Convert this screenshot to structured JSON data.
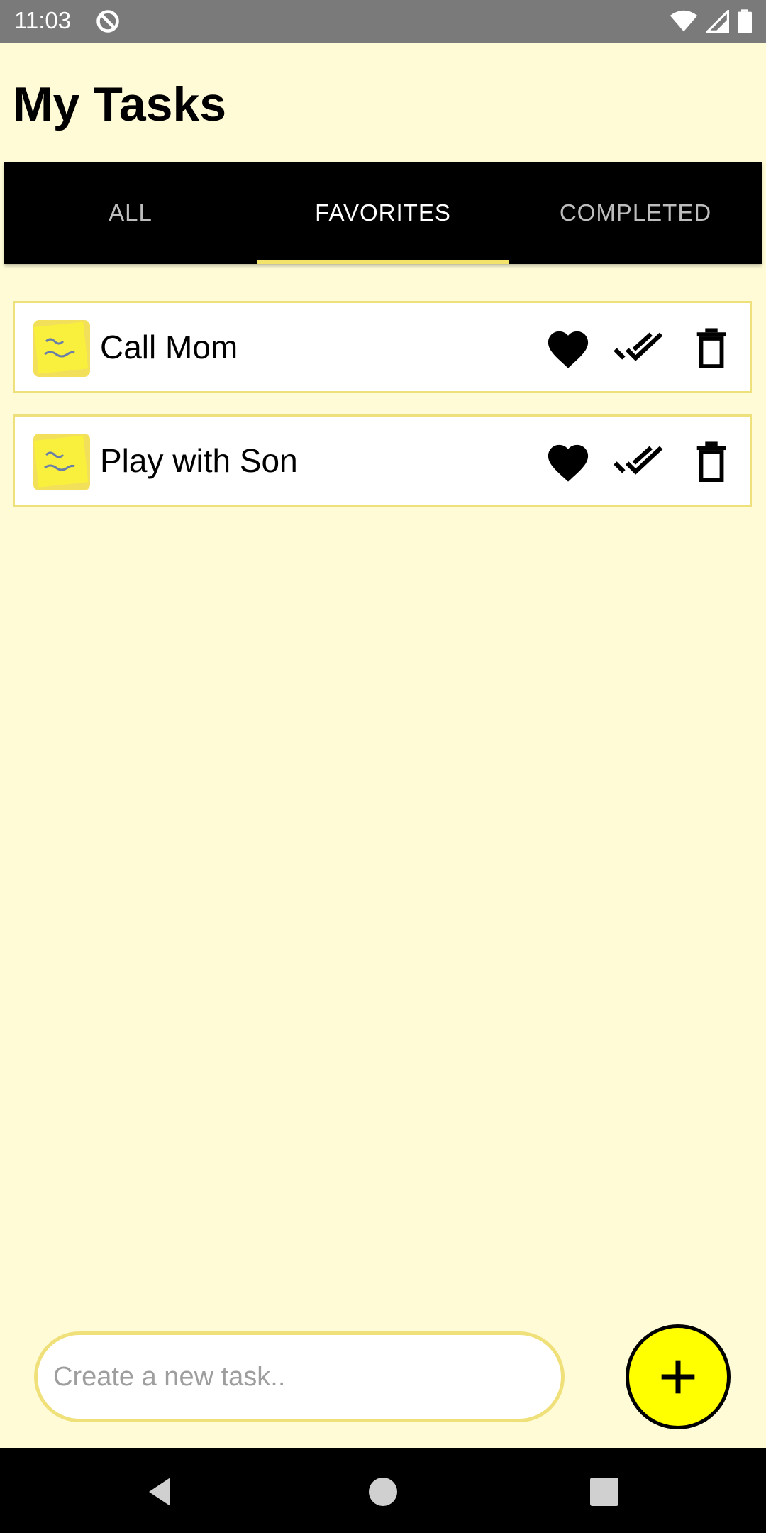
{
  "status_bar": {
    "time": "11:03"
  },
  "page": {
    "title": "My Tasks"
  },
  "tabs": [
    {
      "label": "ALL",
      "active": false
    },
    {
      "label": "FAVORITES",
      "active": true
    },
    {
      "label": "COMPLETED",
      "active": false
    }
  ],
  "tasks": [
    {
      "title": "Call Mom",
      "favorite": true,
      "icon": "sticky-note-thumbnail"
    },
    {
      "title": "Play with Son",
      "favorite": true,
      "icon": "sticky-note-thumbnail"
    }
  ],
  "new_task": {
    "placeholder": "Create a new task.."
  },
  "colors": {
    "background": "#FEFBD6",
    "accent": "#FFFF00",
    "tab_indicator": "#F4E36A",
    "card_border": "#EEE17C"
  }
}
